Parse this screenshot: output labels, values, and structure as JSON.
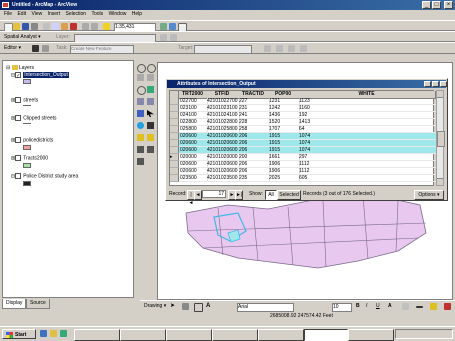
{
  "window": {
    "title": "Untitled - ArcMap - ArcView",
    "min": "_",
    "max": "□",
    "close": "×"
  },
  "menu": [
    "File",
    "Edit",
    "View",
    "Insert",
    "Selection",
    "Tools",
    "Window",
    "Help"
  ],
  "toolbar": {
    "scale": "1:35,431",
    "spatial_analyst_label": "Spatial Analyst ▾",
    "layer_label": "Layer:",
    "editor_label": "Editor ▾",
    "task_label": "Task:",
    "task_value": "Create New Feature",
    "target_label": "Target:"
  },
  "toc": {
    "layers_label": "Layers",
    "items": [
      {
        "name": "Intersection_Output",
        "checked": true,
        "selected": true
      },
      {
        "name": "streets",
        "checked": false
      },
      {
        "name": "Clipped streets",
        "checked": false
      },
      {
        "name": "policedistricts",
        "checked": false
      },
      {
        "name": "Tracts2000",
        "checked": false
      },
      {
        "name": "Police District study area",
        "checked": false
      }
    ]
  },
  "tabs": {
    "display": "Display",
    "source": "Source"
  },
  "attributes": {
    "title": "Attributes of Intersection_Output",
    "columns": [
      "TRT2000",
      "STFID",
      "TRACTID",
      "POP00",
      "WHITE"
    ],
    "rows": [
      [
        "022700",
        "42101022700",
        "227",
        "1231",
        "1123"
      ],
      [
        "023100",
        "42101023100",
        "231",
        "1242",
        "1160"
      ],
      [
        "024100",
        "42101024100",
        "241",
        "1436",
        "192"
      ],
      [
        "022800",
        "42101022800",
        "228",
        "1520",
        "1413"
      ],
      [
        "025800",
        "42101025800",
        "258",
        "1707",
        "64"
      ],
      [
        "020600",
        "42101020600",
        "206",
        "1915",
        "1074"
      ],
      [
        "020600",
        "42101020600",
        "206",
        "1915",
        "1074"
      ],
      [
        "020600",
        "42101020600",
        "206",
        "1915",
        "1074"
      ],
      [
        "020000",
        "42101020000",
        "200",
        "1661",
        "297"
      ],
      [
        "020600",
        "42101020600",
        "206",
        "1906",
        "1112"
      ],
      [
        "020600",
        "42101020600",
        "206",
        "1906",
        "1112"
      ],
      [
        "023500",
        "42101023500",
        "235",
        "2025",
        "605"
      ]
    ],
    "highlighted_rows": [
      5,
      6,
      7
    ],
    "current_row": 8,
    "record_label": "Record:",
    "record_value": "17",
    "show_label": "Show:",
    "show_all": "All",
    "show_selected": "Selected",
    "records_text": "Records (3 out of 176 Selected.)",
    "options": "Options ▾"
  },
  "drawing": {
    "label": "Drawing ▾",
    "font": "Arial",
    "size": "10",
    "bold": "B",
    "italic": "I",
    "underline": "U",
    "text_a": "A"
  },
  "status": {
    "coords": "2685008.92  247574.42 Feet"
  },
  "taskbar": {
    "start": "Start",
    "items": [
      "",
      "",
      "",
      "",
      "",
      "",
      ""
    ],
    "clock": ""
  },
  "colors": {
    "title_start": "#0a246a",
    "title_end": "#3a6ea5",
    "map_fill": "#e8c8ee",
    "map_stroke": "#7a6a8a",
    "selection": "#3fb8e8",
    "highlight": "#9ee8ec"
  }
}
